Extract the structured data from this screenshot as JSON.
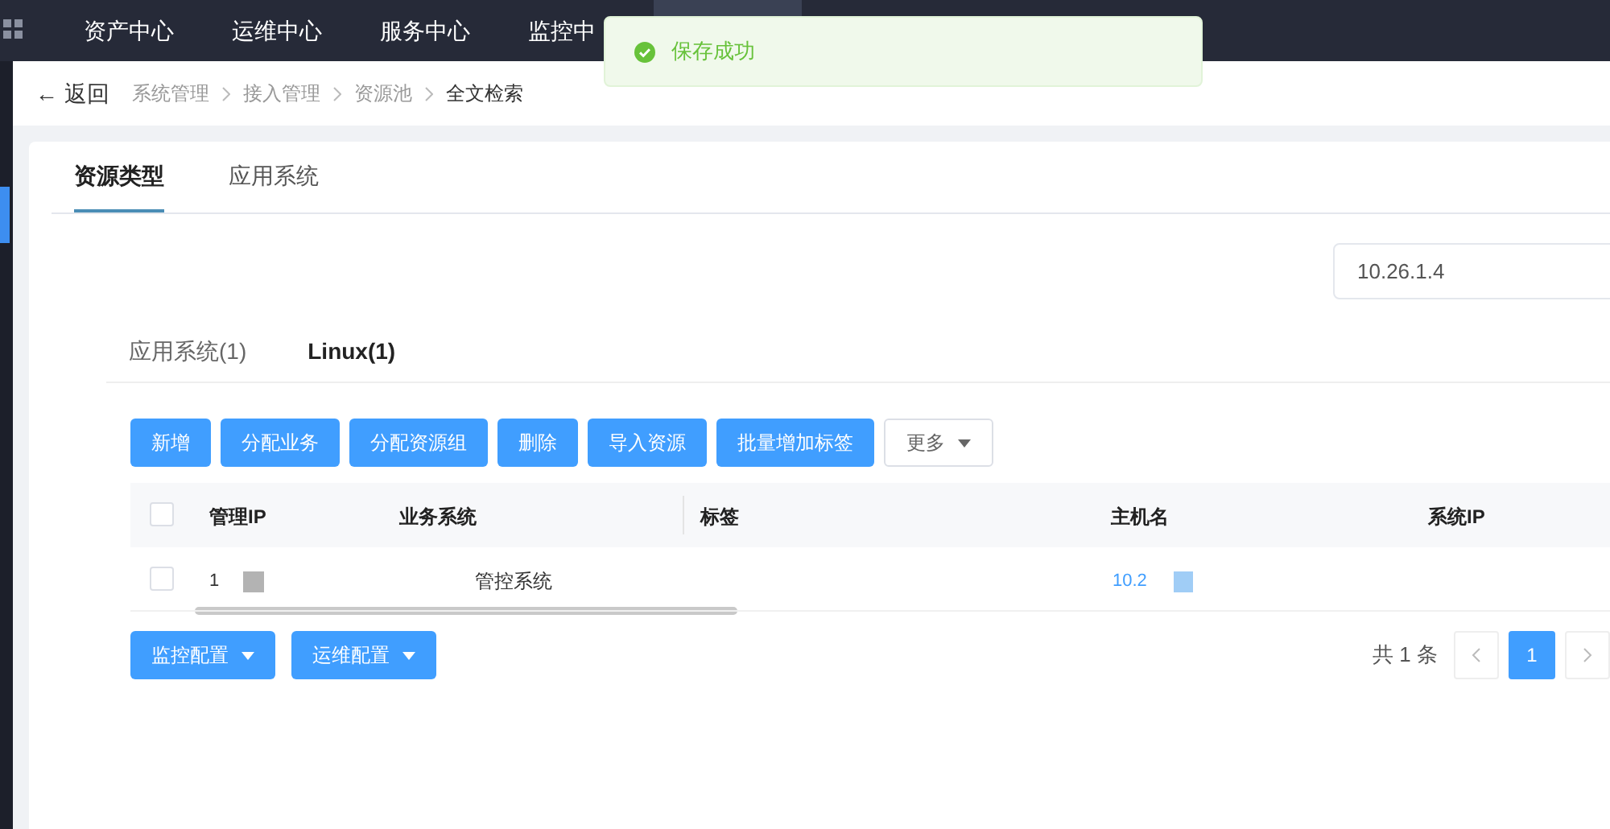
{
  "top_nav": {
    "items": [
      {
        "label": "资产中心",
        "selected": false
      },
      {
        "label": "运维中心",
        "selected": false
      },
      {
        "label": "服务中心",
        "selected": false
      },
      {
        "label": "监控中",
        "selected": false
      },
      {
        "selected": true
      }
    ]
  },
  "toast": {
    "kind": "success",
    "message": "保存成功"
  },
  "breadcrumb": {
    "back": "← 返回",
    "items": [
      "系统管理",
      "接入管理",
      "资源池",
      "全文检索"
    ]
  },
  "main_tabs": [
    {
      "label": "资源类型",
      "selected": true
    },
    {
      "label": "应用系统",
      "selected": false
    }
  ],
  "search": {
    "value": "10.26.1.4"
  },
  "sub_tabs": [
    {
      "label": "应用系统(1)",
      "selected": false
    },
    {
      "label": "Linux(1)",
      "selected": true
    }
  ],
  "toolbar": [
    {
      "label": "新增",
      "kind": "primary"
    },
    {
      "label": "分配业务",
      "kind": "primary"
    },
    {
      "label": "分配资源组",
      "kind": "primary"
    },
    {
      "label": "删除",
      "kind": "primary"
    },
    {
      "label": "导入资源",
      "kind": "primary"
    },
    {
      "label": "批量增加标签",
      "kind": "primary"
    },
    {
      "label": "更多",
      "kind": "dropdown"
    }
  ],
  "table": {
    "columns": [
      "管理IP",
      "业务系统",
      "标签",
      "主机名",
      "系统IP"
    ],
    "rows": [
      {
        "checked": false,
        "cells": [
          "1",
          "管控系统",
          "",
          "10.2",
          ""
        ]
      }
    ]
  },
  "header_checked": false,
  "bottom_buttons": [
    "监控配置",
    "运维配置"
  ],
  "pagination": {
    "total": "共 1 条",
    "pages": [
      {
        "label": "1",
        "selected": true
      }
    ]
  }
}
